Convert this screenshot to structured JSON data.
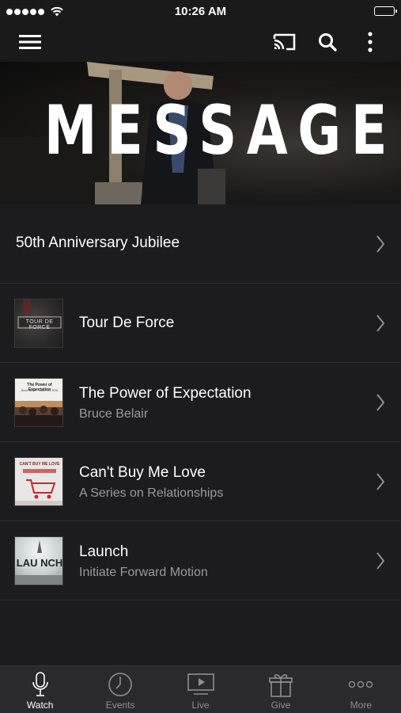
{
  "status_bar": {
    "time": "10:26 AM"
  },
  "hero": {
    "title": "MESSAGES"
  },
  "list": [
    {
      "title": "50th Anniversary Jubilee",
      "subtitle": "",
      "thumb": ""
    },
    {
      "title": "Tour De Force",
      "subtitle": "",
      "thumb": "TOUR DE FORCE"
    },
    {
      "title": "The Power of Expectation",
      "subtitle": "Bruce Belair",
      "thumb": "The Power of Expectation",
      "thumb_sub": "Bruce Belair · March 25, 2016"
    },
    {
      "title": "Can't Buy Me Love",
      "subtitle": "A Series on Relationships",
      "thumb": "CAN'T BUY ME LOVE"
    },
    {
      "title": "Launch",
      "subtitle": "Initiate Forward Motion",
      "thumb": "LAU NCH"
    }
  ],
  "tabs": [
    {
      "label": "Watch",
      "icon": "microphone-icon",
      "active": true
    },
    {
      "label": "Events",
      "icon": "clock-icon"
    },
    {
      "label": "Live",
      "icon": "tv-play-icon"
    },
    {
      "label": "Give",
      "icon": "gift-icon"
    },
    {
      "label": "More",
      "icon": "more-dots-icon"
    }
  ],
  "colors": {
    "background": "#1c1c1e",
    "tab_bar": "#2a2a2c",
    "subtitle": "#9a9a9e",
    "inactive_tab": "#8e8e93"
  }
}
